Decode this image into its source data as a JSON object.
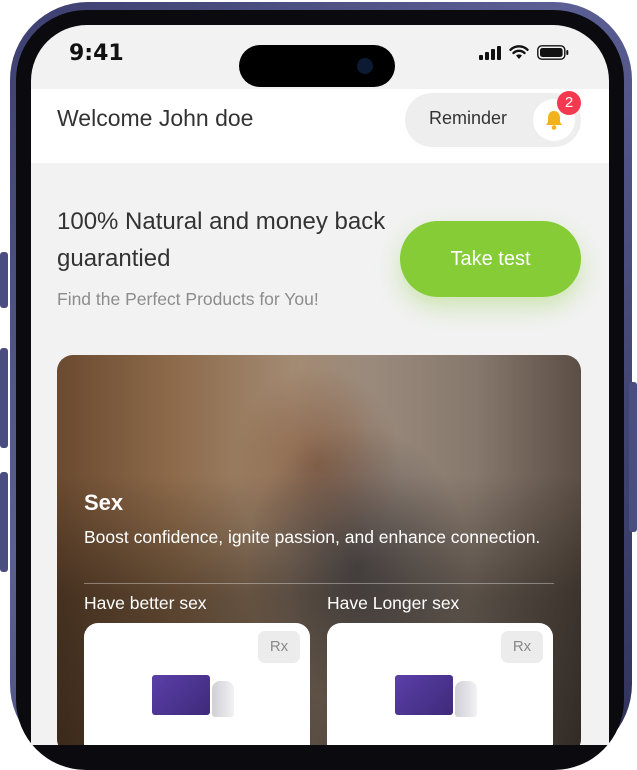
{
  "status_bar": {
    "time": "9:41",
    "icons": [
      "signal-icon",
      "wifi-icon",
      "battery-icon"
    ]
  },
  "header": {
    "welcome": "Welcome John doe",
    "reminder_label": "Reminder",
    "reminder_icon": "bell-icon",
    "badge_count": "2"
  },
  "hero": {
    "headline": "100% Natural and money back guarantied",
    "subline": "Find the Perfect Products for You!",
    "cta_label": "Take test",
    "cta_color": "#86cc37"
  },
  "category_card": {
    "title": "Sex",
    "description": "Boost confidence, ignite passion, and enhance connection.",
    "options": [
      {
        "label": "Have better sex",
        "tag": "Rx"
      },
      {
        "label": "Have Longer sex",
        "tag": "Rx"
      }
    ]
  },
  "colors": {
    "accent": "#86cc37",
    "badge": "#f2394f",
    "frame": "#4a4d80"
  }
}
